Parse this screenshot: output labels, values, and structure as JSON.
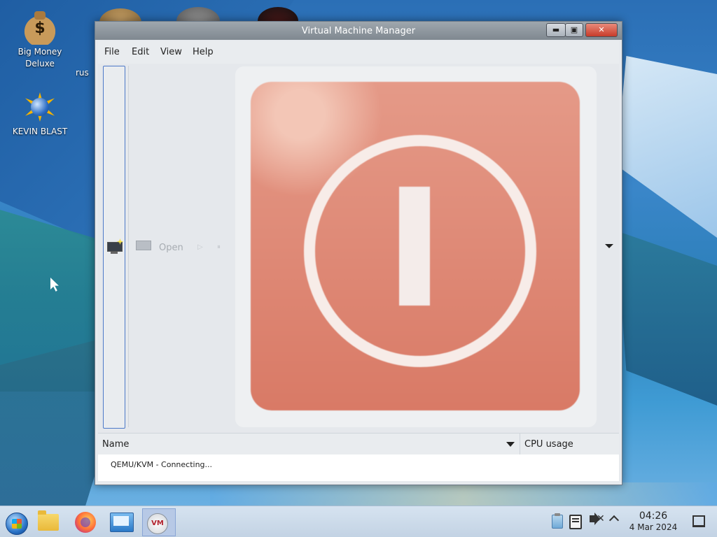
{
  "desktop": {
    "icons": [
      {
        "label_line1": "Big Money",
        "label_line2": "Deluxe",
        "icon": "money-bag-icon"
      },
      {
        "label": "KEVIN BLAST",
        "icon": "sun-globe-icon"
      }
    ],
    "partial_label": "rus"
  },
  "window": {
    "title": "Virtual Machine Manager",
    "controls": {
      "minimize": "▬",
      "maximize": "▣",
      "close": "✕"
    },
    "menu": [
      "File",
      "Edit",
      "View",
      "Help"
    ],
    "toolbar": {
      "new_vm_icon": "new-vm-monitor-icon",
      "open_label": "Open",
      "run_glyph": "▷",
      "pause_glyph": "⏸"
    },
    "overlay_icon": "power-icon",
    "overlay_colors": {
      "panel": "#d97a66",
      "ring": "#f7ece8"
    },
    "list": {
      "columns": [
        "Name",
        "CPU usage"
      ],
      "rows": [
        {
          "name": "QEMU/KVM - Connecting..."
        }
      ]
    }
  },
  "taskbar": {
    "apps": [
      {
        "icon": "start-orb-icon"
      },
      {
        "icon": "file-manager-icon"
      },
      {
        "icon": "firefox-icon"
      },
      {
        "icon": "remote-desktop-icon"
      },
      {
        "icon": "virt-manager-icon",
        "label": "VM",
        "active": true
      }
    ],
    "tray": {
      "icons": [
        "clipboard-icon",
        "clipboard-board-icon",
        "volume-muted-icon",
        "tray-expand-icon"
      ]
    },
    "clock": {
      "time": "04:26",
      "date": "4 Mar 2024"
    }
  }
}
